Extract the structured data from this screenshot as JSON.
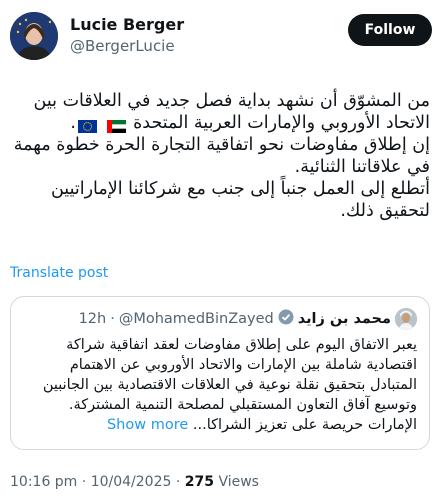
{
  "author": {
    "display_name": "Lucie Berger",
    "handle": "@BergerLucie",
    "follow_label": "Follow"
  },
  "tweet": {
    "paragraph_1": "من المشوّق أن نشهد بداية فصل جديد في العلاقات بين الاتحاد الأوروبي والإمارات العربية المتحدة",
    "paragraph_2": "إن إطلاق مفاوضات نحو اتفاقية التجارة الحرة خطوة مهمة في علاقاتنا الثنائية.",
    "paragraph_3": "أتطلع إلى العمل جنباً إلى جنب مع شركائنا الإماراتيين لتحقيق ذلك.",
    "translate_label": "Translate post"
  },
  "quote": {
    "name": "محمد بن زايد",
    "handle": "@MohamedBinZayed",
    "separator": "·",
    "time": "12h",
    "text": "يعبر الاتفاق اليوم على إطلاق مفاوضات لعقد اتفاقية شراكة اقتصادية شاملة بين الإمارات والاتحاد الأوروبي عن الاهتمام المتبادل بتحقيق نقلة نوعية في العلاقات الاقتصادية بين الجانبين وتوسيع آفاق التعاون المستقبلي لمصلحة التنمية المشتركة. الإمارات حريصة على تعزيز الشراكا...",
    "show_more": "Show more"
  },
  "footer": {
    "time": "10:16 pm",
    "separator": "·",
    "date": "10/04/2025",
    "views_count": "275",
    "views_label": "Views"
  }
}
